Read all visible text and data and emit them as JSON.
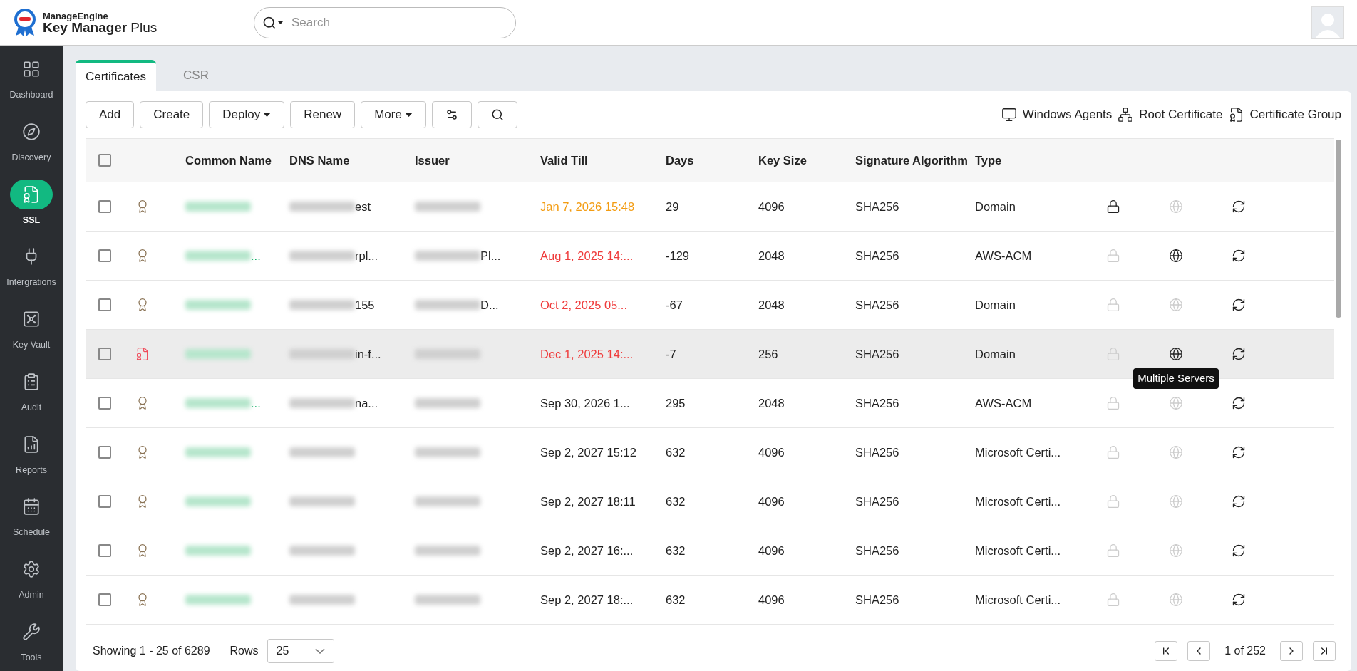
{
  "brand": {
    "company": "ManageEngine",
    "product": "Key Manager",
    "suffix": "Plus"
  },
  "search": {
    "placeholder": "Search"
  },
  "sidebar": {
    "items": [
      {
        "label": "Dashboard",
        "selected": false
      },
      {
        "label": "Discovery",
        "selected": false
      },
      {
        "label": "SSL",
        "selected": true
      },
      {
        "label": "Intergrations",
        "selected": false
      },
      {
        "label": "Key Vault",
        "selected": false
      },
      {
        "label": "Audit",
        "selected": false
      },
      {
        "label": "Reports",
        "selected": false
      },
      {
        "label": "Schedule",
        "selected": false
      },
      {
        "label": "Admin",
        "selected": false
      },
      {
        "label": "Tools",
        "selected": false
      }
    ]
  },
  "tabs": [
    {
      "label": "Certificates",
      "selected": true
    },
    {
      "label": "CSR",
      "selected": false
    }
  ],
  "toolbar": {
    "buttons": [
      {
        "label": "Add",
        "dropdown": false
      },
      {
        "label": "Create",
        "dropdown": false
      },
      {
        "label": "Deploy",
        "dropdown": true
      },
      {
        "label": "Renew",
        "dropdown": false
      },
      {
        "label": "More",
        "dropdown": true
      }
    ],
    "links": [
      {
        "label": "Windows Agents"
      },
      {
        "label": "Root Certificate"
      },
      {
        "label": "Certificate Group"
      }
    ]
  },
  "table": {
    "select_all": {
      "checked": false
    },
    "columns": [
      "Common Name",
      "DNS Name",
      "Issuer",
      "Valid Till",
      "Days",
      "Key Size",
      "Signature Algorithm",
      "Type"
    ],
    "rows": [
      {
        "checked": false,
        "expired": false,
        "common_name": "",
        "dns_name": "est",
        "issuer": "",
        "valid_till": "Jan 7, 2026 15:48",
        "kind": "expiring",
        "days": "29",
        "key_size": "4096",
        "algorithm": "SHA256",
        "type": "Domain",
        "lock_enabled": true,
        "dns_enabled": false,
        "hovered": false
      },
      {
        "checked": false,
        "expired": false,
        "common_name": "...",
        "dns_name": "rpl...",
        "issuer": "Pl...",
        "valid_till": "Aug 1, 2025 14:...",
        "kind": "expired",
        "days": "-129",
        "key_size": "2048",
        "algorithm": "SHA256",
        "type": "AWS-ACM",
        "lock_enabled": false,
        "dns_enabled": true,
        "hovered": false
      },
      {
        "checked": false,
        "expired": false,
        "common_name": "",
        "dns_name": "155",
        "issuer": "D...",
        "valid_till": "Oct 2, 2025 05...",
        "kind": "expired",
        "days": "-67",
        "key_size": "2048",
        "algorithm": "SHA256",
        "type": "Domain",
        "lock_enabled": false,
        "dns_enabled": false,
        "hovered": false
      },
      {
        "checked": false,
        "expired": true,
        "common_name": "",
        "dns_name": "in-f...",
        "issuer": "",
        "valid_till": "Dec 1, 2025 14:...",
        "kind": "expired",
        "days": "-7",
        "key_size": "256",
        "algorithm": "SHA256",
        "type": "Domain",
        "lock_enabled": false,
        "dns_enabled": true,
        "hovered": true,
        "tooltip": "Multiple Servers"
      },
      {
        "checked": false,
        "expired": false,
        "common_name": "...",
        "dns_name": "na...",
        "issuer": "",
        "valid_till": "Sep 30, 2026 1...",
        "kind": "valid",
        "days": "295",
        "key_size": "2048",
        "algorithm": "SHA256",
        "type": "AWS-ACM",
        "lock_enabled": false,
        "dns_enabled": false,
        "hovered": false
      },
      {
        "checked": false,
        "expired": false,
        "common_name": "",
        "dns_name": "",
        "issuer": "",
        "valid_till": "Sep 2, 2027 15:12",
        "kind": "valid",
        "days": "632",
        "key_size": "4096",
        "algorithm": "SHA256",
        "type": "Microsoft Certi...",
        "lock_enabled": false,
        "dns_enabled": false,
        "hovered": false
      },
      {
        "checked": false,
        "expired": false,
        "common_name": "",
        "dns_name": "",
        "issuer": "",
        "valid_till": "Sep 2, 2027 18:11",
        "kind": "valid",
        "days": "632",
        "key_size": "4096",
        "algorithm": "SHA256",
        "type": "Microsoft Certi...",
        "lock_enabled": false,
        "dns_enabled": false,
        "hovered": false
      },
      {
        "checked": false,
        "expired": false,
        "common_name": "",
        "dns_name": "",
        "issuer": "",
        "valid_till": "Sep 2, 2027 16:...",
        "kind": "valid",
        "days": "632",
        "key_size": "4096",
        "algorithm": "SHA256",
        "type": "Microsoft Certi...",
        "lock_enabled": false,
        "dns_enabled": false,
        "hovered": false
      },
      {
        "checked": false,
        "expired": false,
        "common_name": "",
        "dns_name": "",
        "issuer": "",
        "valid_till": "Sep 2, 2027 18:...",
        "kind": "valid",
        "days": "632",
        "key_size": "4096",
        "algorithm": "SHA256",
        "type": "Microsoft Certi...",
        "lock_enabled": false,
        "dns_enabled": false,
        "hovered": false
      }
    ]
  },
  "footer": {
    "showing": "Showing 1 - 25 of 6289",
    "rows_label": "Rows",
    "rows_value": "25",
    "page": "1 of 252"
  }
}
